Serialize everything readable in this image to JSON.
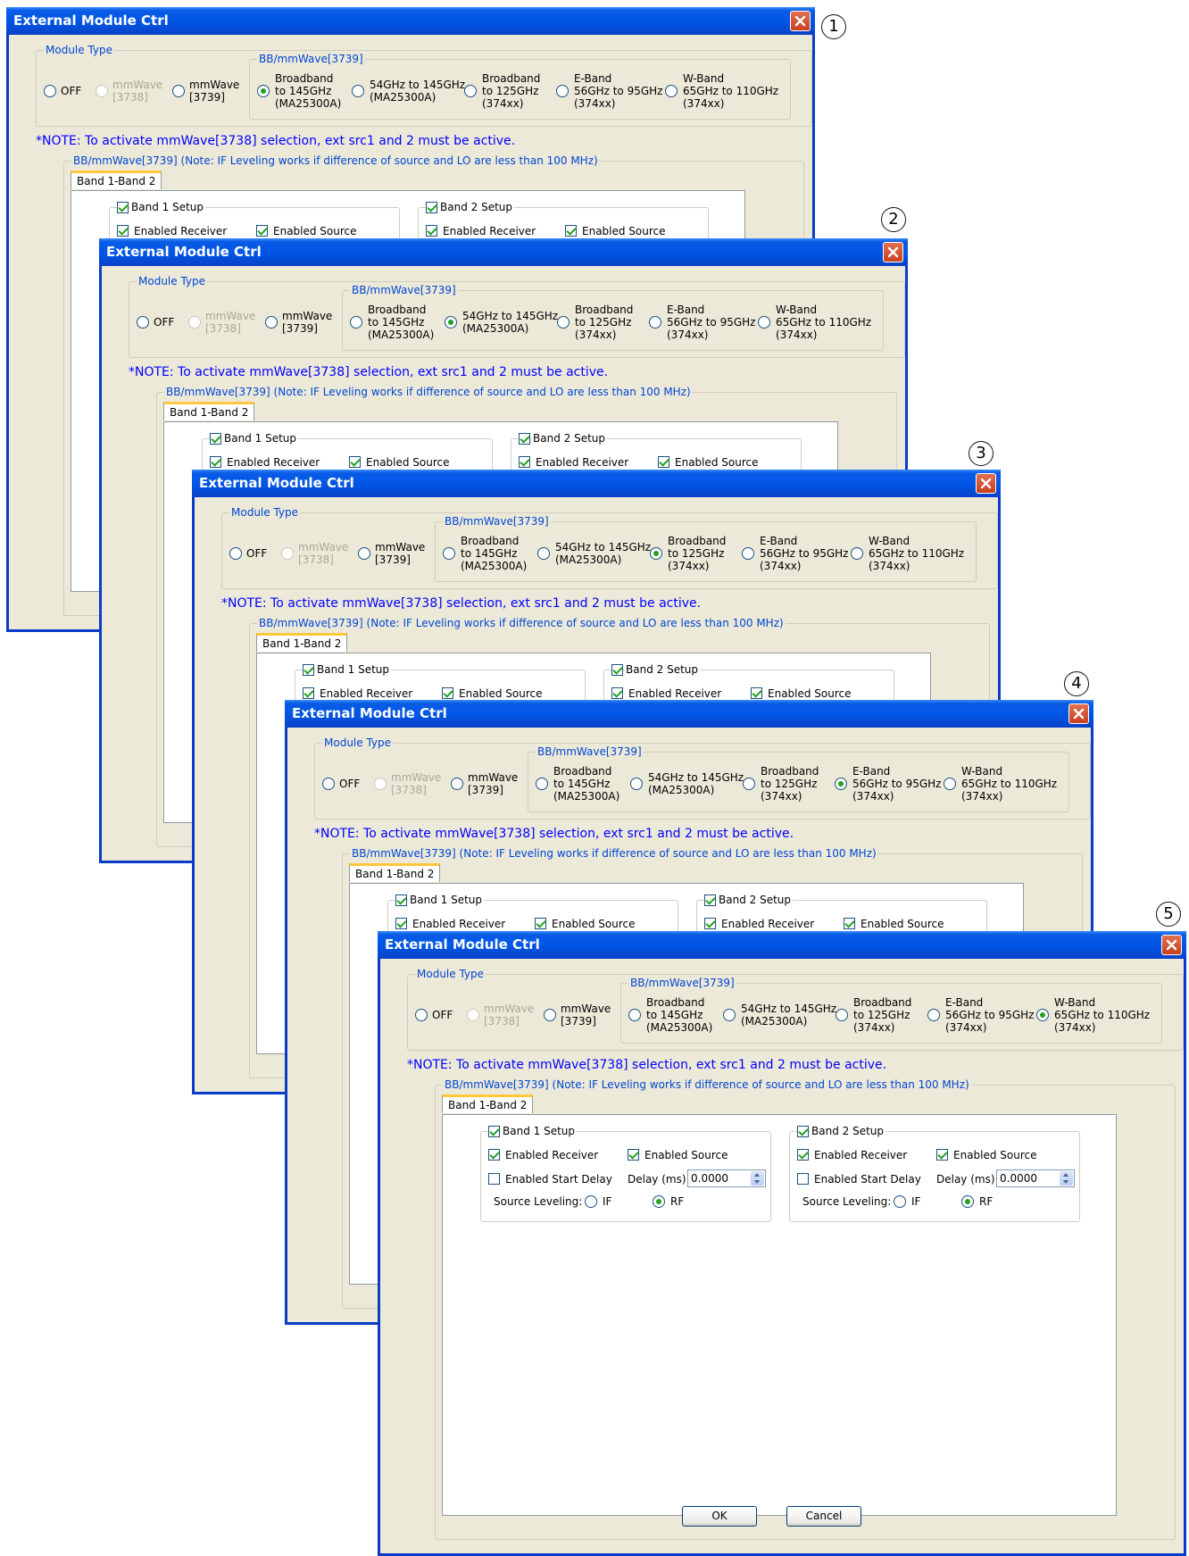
{
  "windows": [
    {
      "callout": "1",
      "title": "External Module Ctrl",
      "module_type_label": "Module Type",
      "off_label": "OFF",
      "mm3738_label": "mmWave\n[3738]",
      "mm3739_label": "mmWave\n[3739]",
      "bb_group_label": "BB/mmWave[3739]",
      "band_options": [
        "Broadband\nto 145GHz\n(MA25300A)",
        "54GHz to 145GHz\n(MA25300A)",
        "Broadband\nto 125GHz\n(374xx)",
        "E-Band\n56GHz to 95GHz\n(374xx)",
        "W-Band\n65GHz to 110GHz\n(374xx)"
      ],
      "selected_band": 0,
      "note": "*NOTE:  To activate mmWave[3738] selection, ext src1 and 2 must be active.",
      "bb_group2_label": "BB/mmWave[3739]  (Note: IF Leveling works if difference of source and LO are less than 100 MHz)",
      "tab_label": "Band 1-Band 2",
      "band1_setup": "Band 1 Setup",
      "band2_setup": "Band 2 Setup",
      "enabled_receiver": "Enabled Receiver",
      "enabled_source": "Enabled Source"
    },
    {
      "callout": "2",
      "title": "External Module Ctrl",
      "module_type_label": "Module Type",
      "off_label": "OFF",
      "mm3738_label": "mmWave\n[3738]",
      "mm3739_label": "mmWave\n[3739]",
      "bb_group_label": "BB/mmWave[3739]",
      "band_options": [
        "Broadband\nto 145GHz\n(MA25300A)",
        "54GHz to 145GHz\n(MA25300A)",
        "Broadband\nto 125GHz\n(374xx)",
        "E-Band\n56GHz to 95GHz\n(374xx)",
        "W-Band\n65GHz to 110GHz\n(374xx)"
      ],
      "selected_band": 1,
      "note": "*NOTE:  To activate mmWave[3738] selection, ext src1 and 2 must be active.",
      "bb_group2_label": "BB/mmWave[3739]  (Note: IF Leveling works if difference of source and LO are less than 100 MHz)",
      "tab_label": "Band 1-Band 2",
      "band1_setup": "Band 1 Setup",
      "band2_setup": "Band 2 Setup",
      "enabled_receiver": "Enabled Receiver",
      "enabled_source": "Enabled Source"
    },
    {
      "callout": "3",
      "title": "External Module Ctrl",
      "module_type_label": "Module Type",
      "off_label": "OFF",
      "mm3738_label": "mmWave\n[3738]",
      "mm3739_label": "mmWave\n[3739]",
      "bb_group_label": "BB/mmWave[3739]",
      "band_options": [
        "Broadband\nto 145GHz\n(MA25300A)",
        "54GHz to 145GHz\n(MA25300A)",
        "Broadband\nto 125GHz\n(374xx)",
        "E-Band\n56GHz to 95GHz\n(374xx)",
        "W-Band\n65GHz to 110GHz\n(374xx)"
      ],
      "selected_band": 2,
      "note": "*NOTE:  To activate mmWave[3738] selection, ext src1 and 2 must be active.",
      "bb_group2_label": "BB/mmWave[3739]  (Note: IF Leveling works if difference of source and LO are less than 100 MHz)",
      "tab_label": "Band 1-Band 2",
      "band1_setup": "Band 1 Setup",
      "band2_setup": "Band 2 Setup",
      "enabled_receiver": "Enabled Receiver",
      "enabled_source": "Enabled Source"
    },
    {
      "callout": "4",
      "title": "External Module Ctrl",
      "module_type_label": "Module Type",
      "off_label": "OFF",
      "mm3738_label": "mmWave\n[3738]",
      "mm3739_label": "mmWave\n[3739]",
      "bb_group_label": "BB/mmWave[3739]",
      "band_options": [
        "Broadband\nto 145GHz\n(MA25300A)",
        "54GHz to 145GHz\n(MA25300A)",
        "Broadband\nto 125GHz\n(374xx)",
        "E-Band\n56GHz to 95GHz\n(374xx)",
        "W-Band\n65GHz to 110GHz\n(374xx)"
      ],
      "selected_band": 3,
      "note": "*NOTE:  To activate mmWave[3738] selection, ext src1 and 2 must be active.",
      "bb_group2_label": "BB/mmWave[3739]  (Note: IF Leveling works if difference of source and LO are less than 100 MHz)",
      "tab_label": "Band 1-Band 2",
      "band1_setup": "Band 1 Setup",
      "band2_setup": "Band 2 Setup",
      "enabled_receiver": "Enabled Receiver",
      "enabled_source": "Enabled Source"
    },
    {
      "callout": "5",
      "title": "External Module Ctrl",
      "module_type_label": "Module Type",
      "off_label": "OFF",
      "mm3738_label": "mmWave\n[3738]",
      "mm3739_label": "mmWave\n[3739]",
      "bb_group_label": "BB/mmWave[3739]",
      "band_options": [
        "Broadband\nto 145GHz\n(MA25300A)",
        "54GHz to 145GHz\n(MA25300A)",
        "Broadband\nto 125GHz\n(374xx)",
        "E-Band\n56GHz to 95GHz\n(374xx)",
        "W-Band\n65GHz to 110GHz\n(374xx)"
      ],
      "selected_band": 4,
      "note": "*NOTE:  To activate mmWave[3738] selection, ext src1 and 2 must be active.",
      "bb_group2_label": "BB/mmWave[3739]  (Note: IF Leveling works if difference of source and LO are less than 100 MHz)",
      "tab_label": "Band 1-Band 2",
      "band1_setup": "Band 1 Setup",
      "band2_setup": "Band 2 Setup",
      "enabled_receiver": "Enabled Receiver",
      "enabled_source": "Enabled Source"
    }
  ],
  "detail": {
    "enabled_start_delay": "Enabled Start Delay",
    "delay_label": "Delay (ms) :",
    "band1_delay": "0.0000",
    "band2_delay": "0.0000",
    "source_leveling": "Source Leveling:",
    "if_label": "IF",
    "rf_label": "RF",
    "ok": "OK",
    "cancel": "Cancel"
  },
  "colors": {
    "title_blue": "#0055E5",
    "note_blue": "#0000FF",
    "dialog_bg": "#ECE9D8",
    "group_label": "#0046D5"
  }
}
